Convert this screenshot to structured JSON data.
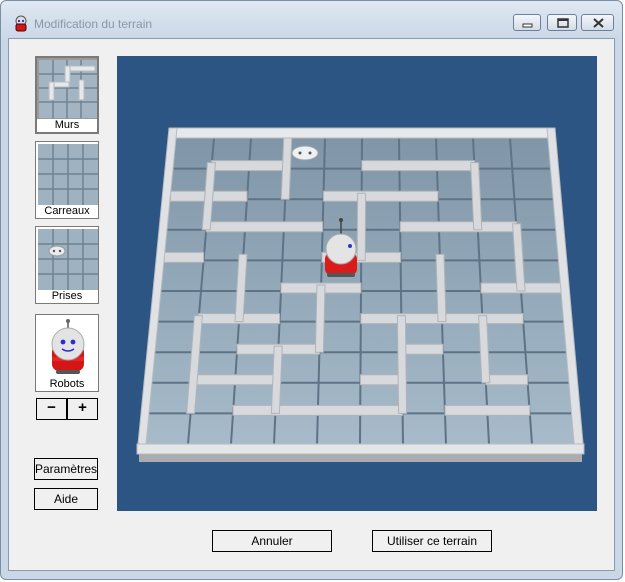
{
  "window": {
    "title": "Modification du terrain",
    "icon": "robot-icon"
  },
  "tools": {
    "walls_label": "Murs",
    "tiles_label": "Carreaux",
    "outlets_label": "Prises",
    "robots_label": "Robots",
    "decrease_label": "−",
    "increase_label": "+"
  },
  "side_buttons": {
    "settings_label": "Paramètres",
    "help_label": "Aide"
  },
  "footer": {
    "cancel_label": "Annuler",
    "use_label": "Utiliser ce terrain"
  },
  "colors": {
    "viewport_bg": "#2d5583",
    "floor": "#8fa6b8",
    "wall": "#c9ccd0",
    "robot_body": "#e02020"
  }
}
